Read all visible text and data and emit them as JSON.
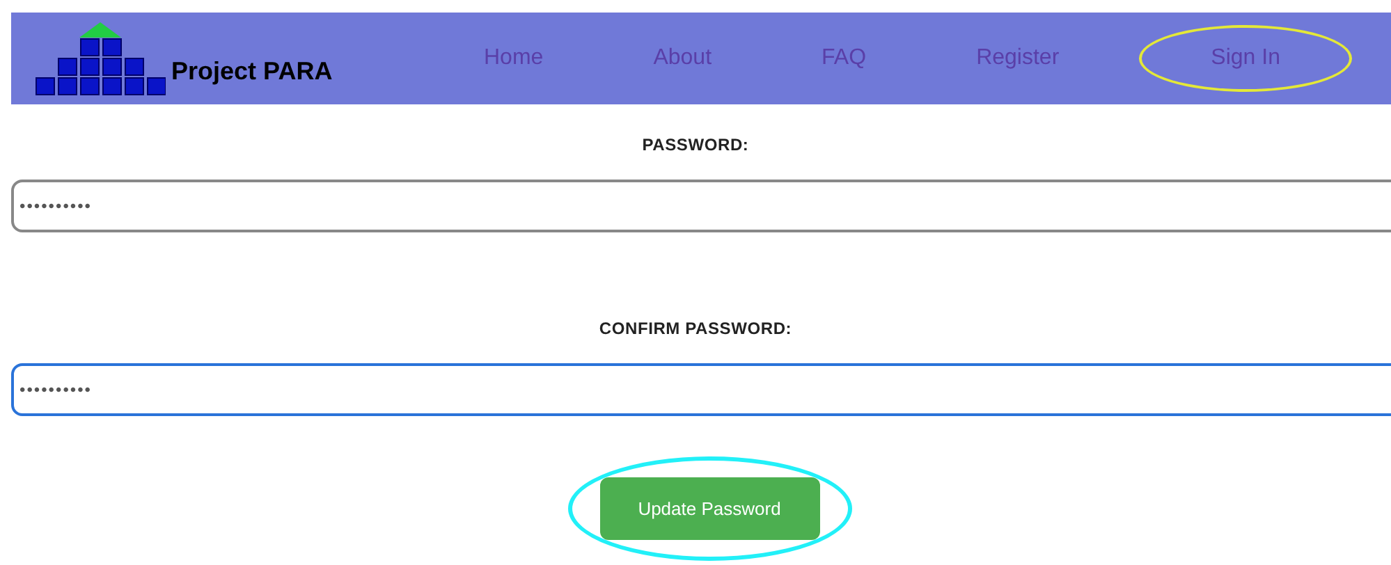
{
  "header": {
    "logo_text": "Project PARA",
    "nav": [
      {
        "label": "Home",
        "highlighted": false
      },
      {
        "label": "About",
        "highlighted": false
      },
      {
        "label": "FAQ",
        "highlighted": false
      },
      {
        "label": "Register",
        "highlighted": false
      },
      {
        "label": "Sign In",
        "highlighted": true
      }
    ]
  },
  "fields": [
    {
      "label": "PASSWORD:",
      "value": "••••••••••",
      "focused": false
    },
    {
      "label": "CONFIRM PASSWORD:",
      "value": "••••••••••",
      "focused": true
    }
  ],
  "submit": {
    "label": "Update Password",
    "highlighted": true
  }
}
